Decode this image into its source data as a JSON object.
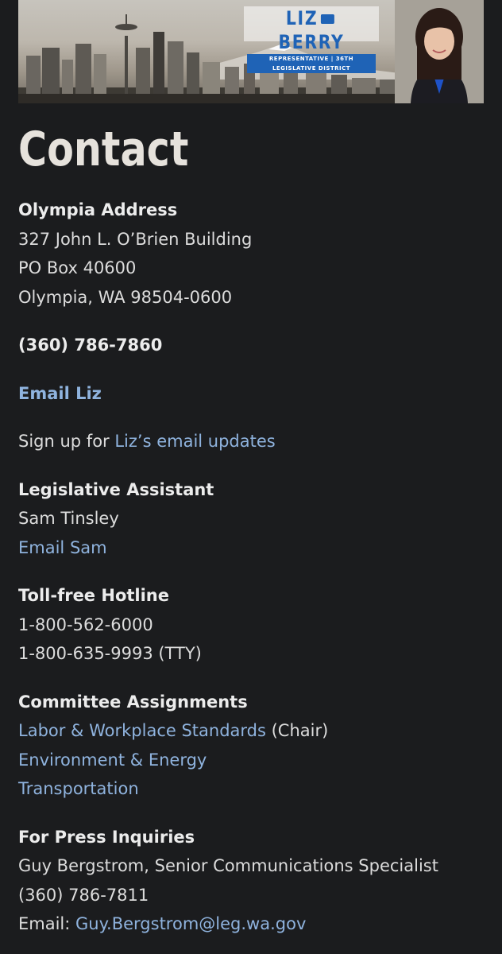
{
  "banner": {
    "name_first": "LIZ",
    "name_last": "BERRY",
    "subtitle": "REPRESENTATIVE | 36TH LEGISLATIVE DISTRICT"
  },
  "page_title": "Contact",
  "olympia": {
    "label": "Olympia Address",
    "line1": "327 John L. O’Brien Building",
    "line2": "PO Box 40600",
    "line3": "Olympia, WA 98504-0600"
  },
  "phone": "(360) 786-7860",
  "email_link": "Email Liz",
  "signup": {
    "prefix": "Sign up for ",
    "link": "Liz’s email updates"
  },
  "assistant": {
    "label": "Legislative Assistant",
    "name": "Sam Tinsley",
    "email_link": "Email Sam"
  },
  "hotline": {
    "label": "Toll-free Hotline",
    "number1": "1-800-562-6000",
    "number2": "1-800-635-9993 (TTY)"
  },
  "committees": {
    "label": "Committee Assignments",
    "items": [
      {
        "name": "Labor & Workplace Standards",
        "suffix": " (Chair)"
      },
      {
        "name": "Environment & Energy",
        "suffix": ""
      },
      {
        "name": "Transportation",
        "suffix": ""
      }
    ]
  },
  "press": {
    "label": "For Press Inquiries",
    "contact": "Guy Bergstrom, Senior Communications Specialist",
    "phone": "(360) 786-7811",
    "email_prefix": "Email: ",
    "email": "Guy.Bergstrom@leg.wa.gov"
  },
  "colors": {
    "background": "#1b1c1e",
    "link": "#8fb3de",
    "brand_blue": "#1f63b6"
  }
}
